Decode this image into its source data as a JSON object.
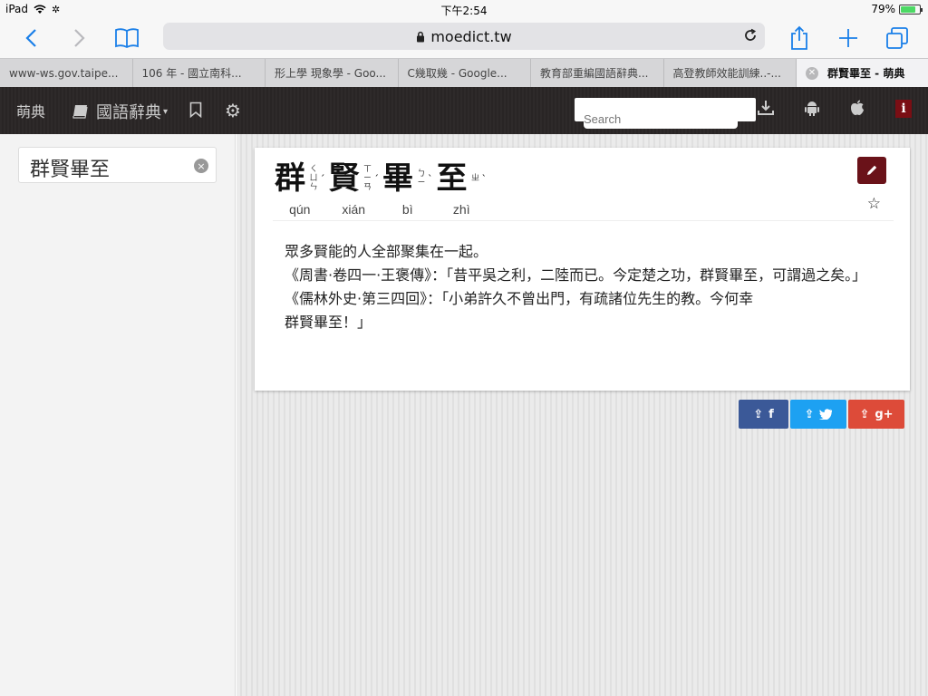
{
  "status_bar": {
    "device": "iPad",
    "time": "下午2:54",
    "battery_percent": "79%",
    "battery_level": 0.79
  },
  "browser": {
    "url": "moedict.tw",
    "tabs": [
      {
        "label": "www-ws.gov.taipe..."
      },
      {
        "label": "106 年 - 國立南科..."
      },
      {
        "label": "形上學 現象學 - Goo..."
      },
      {
        "label": "C幾取幾 - Google..."
      },
      {
        "label": "教育部重編國語辭典..."
      },
      {
        "label": "高登教師效能訓練..-..."
      },
      {
        "label": "群賢畢至 - 萌典"
      }
    ]
  },
  "navbar": {
    "logo": "萌典",
    "dictionary": "國語辭典",
    "search_placeholder": "Search",
    "info": "i"
  },
  "sidebar": {
    "query": "群賢畢至",
    "clear": "×"
  },
  "entry": {
    "characters": [
      {
        "char": "群",
        "bopomofo": [
          "ㄑ",
          "ㄩ",
          "ㄣ"
        ],
        "tone": "ˊ",
        "pinyin": "qún"
      },
      {
        "char": "賢",
        "bopomofo": [
          "ㄒ",
          "ㄧ",
          "ㄢ"
        ],
        "tone": "ˊ",
        "pinyin": "xián"
      },
      {
        "char": "畢",
        "bopomofo": [
          "ㄅ",
          "ㄧ"
        ],
        "tone": "ˋ",
        "pinyin": "bì"
      },
      {
        "char": "至",
        "bopomofo": [
          "ㄓ"
        ],
        "tone": "ˋ",
        "pinyin": "zhì"
      }
    ],
    "definition": "眾多賢能的人全部聚集在一起。",
    "examples": [
      "《周書·卷四一·王褒傳》：「昔平吳之利，二陸而已。今定楚之功，群賢畢至，可謂過之矣。」",
      "《儒林外史·第三四回》：「小弟許久不曾出門，有疏諸位先生的教。今何幸",
      "群賢畢至！」"
    ]
  },
  "share": {
    "facebook": "f",
    "twitter": "",
    "google_plus": "g+"
  },
  "colors": {
    "accent": "#1a7fe8",
    "brand": "#6a1219",
    "facebook": "#3b5998",
    "twitter": "#1da1f2",
    "google_plus": "#dd4b39"
  }
}
